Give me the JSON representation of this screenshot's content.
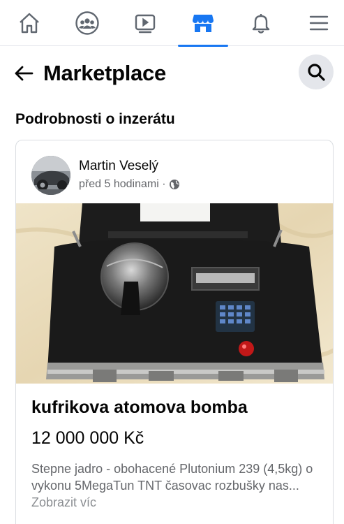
{
  "nav": {
    "items": [
      {
        "icon": "home-icon",
        "active": false
      },
      {
        "icon": "groups-icon",
        "active": false
      },
      {
        "icon": "video-icon",
        "active": false
      },
      {
        "icon": "marketplace-icon",
        "active": true
      },
      {
        "icon": "bell-icon",
        "active": false
      },
      {
        "icon": "menu-icon",
        "active": false
      }
    ],
    "accent_color": "#1877f2"
  },
  "header": {
    "title": "Marketplace",
    "back_icon": "arrow-left-icon",
    "search_icon": "search-icon"
  },
  "section_title": "Podrobnosti o inzerátu",
  "post": {
    "author": "Martin Veselý",
    "time": "před 5 hodinami ·",
    "privacy_icon": "globe-icon",
    "listing": {
      "title": "kufrikova atomova bomba",
      "price": "12 000 000 Kč",
      "description": "Stepne jadro - obohacené Plutonium 239 (4,5kg) o vykonu 5MegaTun TNT časovac rozbušky nas...",
      "see_more": "Zobrazit víc"
    }
  }
}
